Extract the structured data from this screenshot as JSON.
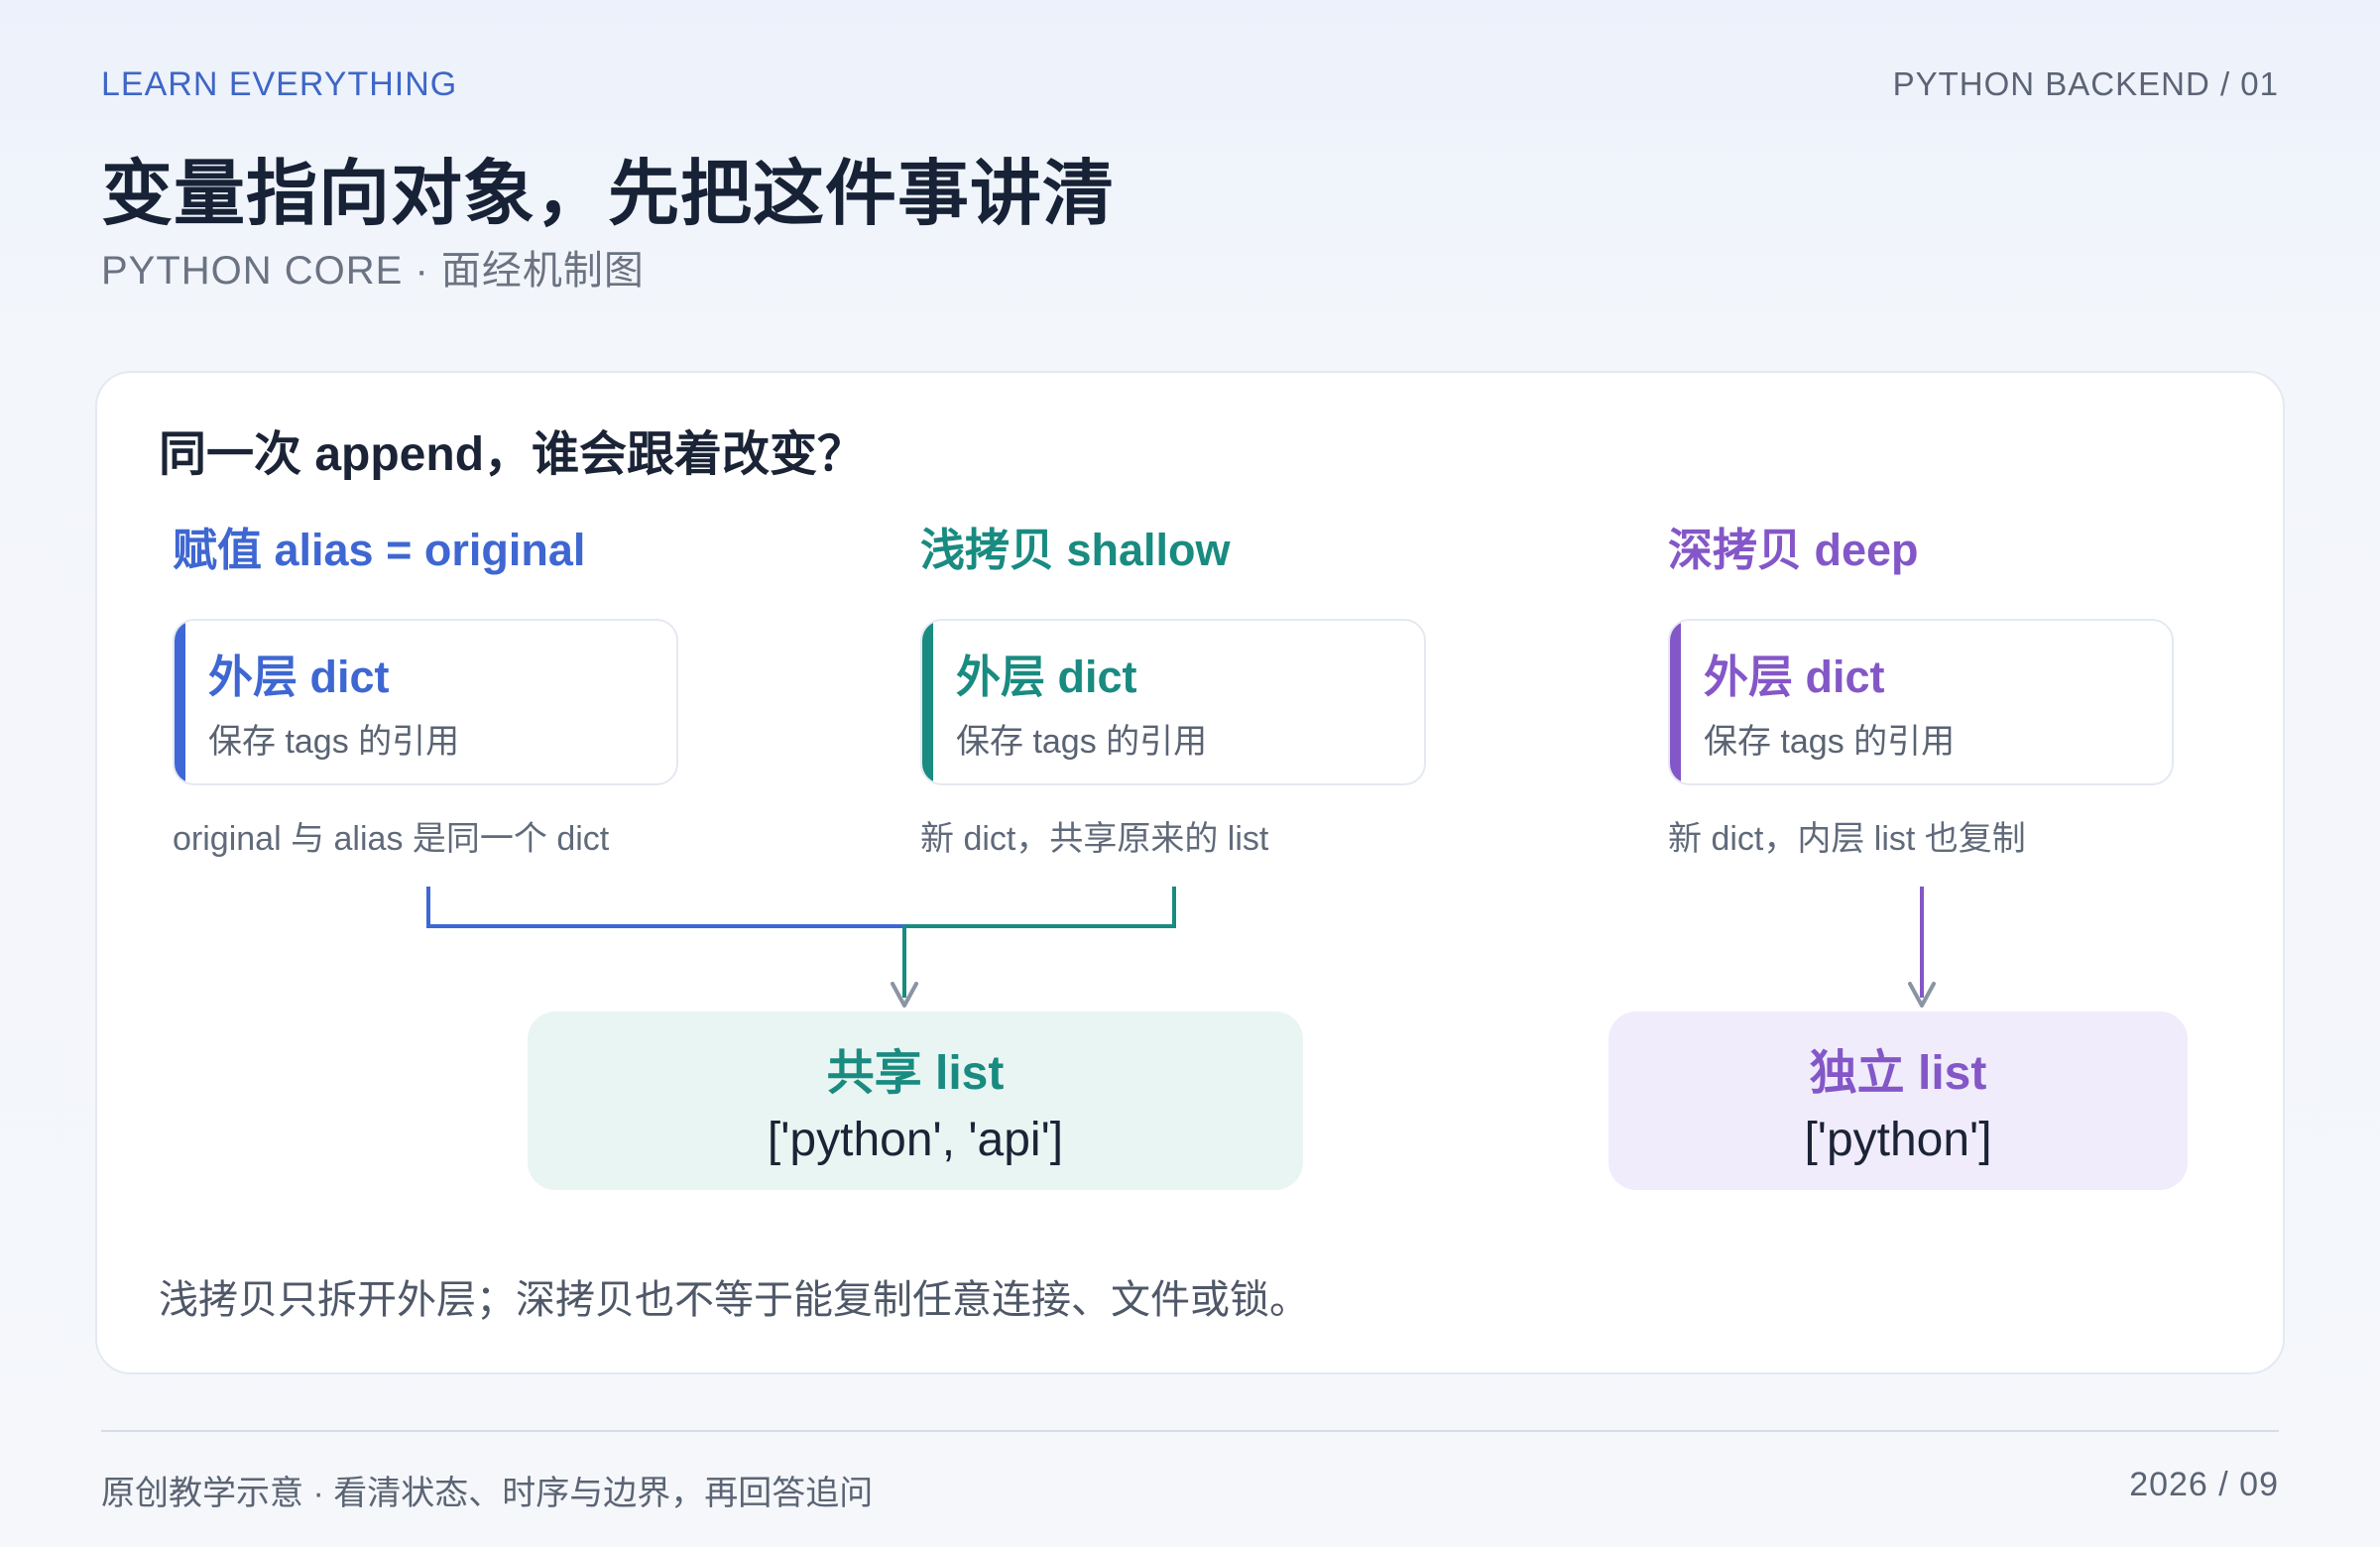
{
  "header": {
    "brand": "LEARN EVERYTHING",
    "meta": "PYTHON BACKEND / 01",
    "title": "变量指向对象，先把这件事讲清",
    "subtitle": "PYTHON CORE · 面经机制图"
  },
  "panel": {
    "question": "同一次 append，谁会跟着改变？",
    "columns": [
      {
        "title": "赋值 alias = original",
        "card_title": "外层 dict",
        "card_desc": "保存 tags 的引用",
        "note": "original 与 alias 是同一个 dict",
        "color": "#3e67d2"
      },
      {
        "title": "浅拷贝 shallow",
        "card_title": "外层 dict",
        "card_desc": "保存 tags 的引用",
        "note": "新 dict，共享原来的 list",
        "color": "#198b80"
      },
      {
        "title": "深拷贝 deep",
        "card_title": "外层 dict",
        "card_desc": "保存 tags 的引用",
        "note": "新 dict，内层 list 也复制",
        "color": "#8457c8"
      }
    ],
    "shared_list": {
      "title": "共享 list",
      "value": "['python', 'api']",
      "color": "#e9f5f2"
    },
    "independent_list": {
      "title": "独立 list",
      "value": "['python']",
      "color": "#f0ecfb"
    },
    "footnote": "浅拷贝只拆开外层；深拷贝也不等于能复制任意连接、文件或锁。"
  },
  "footer": {
    "left": "原创教学示意 · 看清状态、时序与边界，再回答追问",
    "right": "2026 / 09"
  },
  "colors": {
    "accent_blue": "#3e67d2",
    "accent_teal": "#198b80",
    "accent_purple": "#8457c8",
    "arrow_gray": "#8a94a3"
  }
}
